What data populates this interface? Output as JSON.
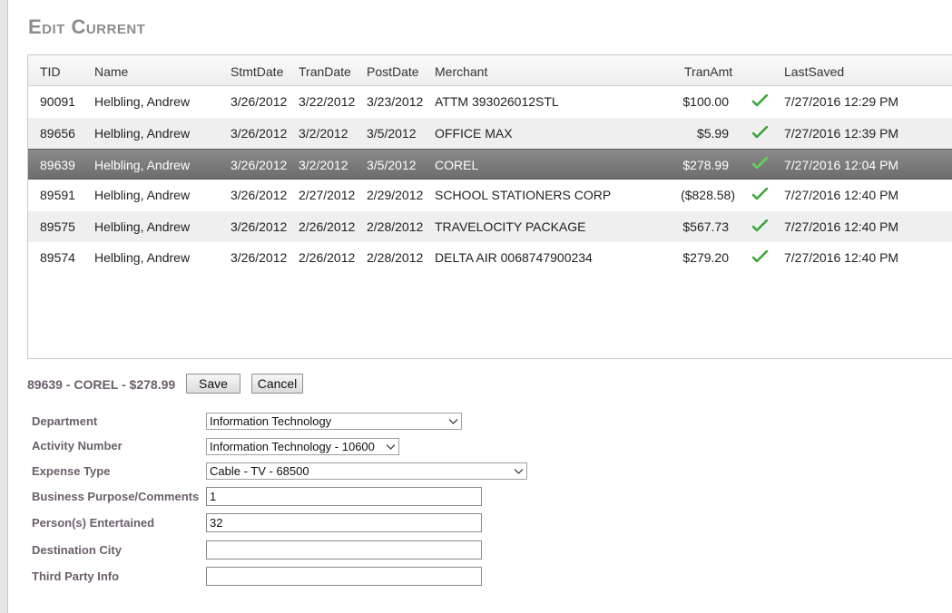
{
  "page": {
    "title": "Edit Current"
  },
  "grid": {
    "columns": {
      "tid": "TID",
      "name": "Name",
      "stmt_date": "StmtDate",
      "tran_date": "TranDate",
      "post_date": "PostDate",
      "merchant": "Merchant",
      "tran_amt": "TranAmt",
      "last_saved": "LastSaved"
    },
    "rows": [
      {
        "tid": "90091",
        "name": "Helbling, Andrew",
        "stmt_date": "3/26/2012",
        "tran_date": "3/22/2012",
        "post_date": "3/23/2012",
        "merchant": "ATTM 393026012STL",
        "tran_amt": "$100.00",
        "status_icon": "check-icon",
        "last_saved": "7/27/2016 12:29 PM"
      },
      {
        "tid": "89656",
        "name": "Helbling, Andrew",
        "stmt_date": "3/26/2012",
        "tran_date": "3/2/2012",
        "post_date": "3/5/2012",
        "merchant": "OFFICE MAX",
        "tran_amt": "$5.99",
        "status_icon": "check-icon",
        "last_saved": "7/27/2016 12:39 PM"
      },
      {
        "tid": "89639",
        "name": "Helbling, Andrew",
        "stmt_date": "3/26/2012",
        "tran_date": "3/2/2012",
        "post_date": "3/5/2012",
        "merchant": "COREL",
        "tran_amt": "$278.99",
        "status_icon": "check-icon",
        "last_saved": "7/27/2016 12:04 PM",
        "selected": true
      },
      {
        "tid": "89591",
        "name": "Helbling, Andrew",
        "stmt_date": "3/26/2012",
        "tran_date": "2/27/2012",
        "post_date": "2/29/2012",
        "merchant": "SCHOOL STATIONERS CORP",
        "tran_amt": "($828.58)",
        "status_icon": "check-icon",
        "last_saved": "7/27/2016 12:40 PM"
      },
      {
        "tid": "89575",
        "name": "Helbling, Andrew",
        "stmt_date": "3/26/2012",
        "tran_date": "2/26/2012",
        "post_date": "2/28/2012",
        "merchant": "TRAVELOCITY PACKAGE",
        "tran_amt": "$567.73",
        "status_icon": "check-icon",
        "last_saved": "7/27/2016 12:40 PM"
      },
      {
        "tid": "89574",
        "name": "Helbling, Andrew",
        "stmt_date": "3/26/2012",
        "tran_date": "2/26/2012",
        "post_date": "2/28/2012",
        "merchant": "DELTA AIR 0068747900234",
        "tran_amt": "$279.20",
        "status_icon": "check-icon",
        "last_saved": "7/27/2016 12:40 PM"
      }
    ]
  },
  "edit": {
    "summary": "89639 - COREL - $278.99",
    "save_label": "Save",
    "cancel_label": "Cancel",
    "fields": {
      "department": {
        "label": "Department",
        "value": "Information Technology"
      },
      "activity_number": {
        "label": "Activity Number",
        "value": "Information Technology - 10600"
      },
      "expense_type": {
        "label": "Expense Type",
        "value": "Cable - TV - 68500"
      },
      "business_purpose": {
        "label": "Business Purpose/Comments",
        "value": "1"
      },
      "persons_entertained": {
        "label": "Person(s) Entertained",
        "value": "32"
      },
      "destination_city": {
        "label": "Destination City",
        "value": ""
      },
      "third_party_info": {
        "label": "Third Party Info",
        "value": ""
      }
    }
  },
  "colors": {
    "label_text": "#6b5f6b",
    "title_text": "#8c8c8c",
    "row_selected": "#7a7a7a",
    "row_alt": "#efefef",
    "check": "#3aa53a"
  }
}
